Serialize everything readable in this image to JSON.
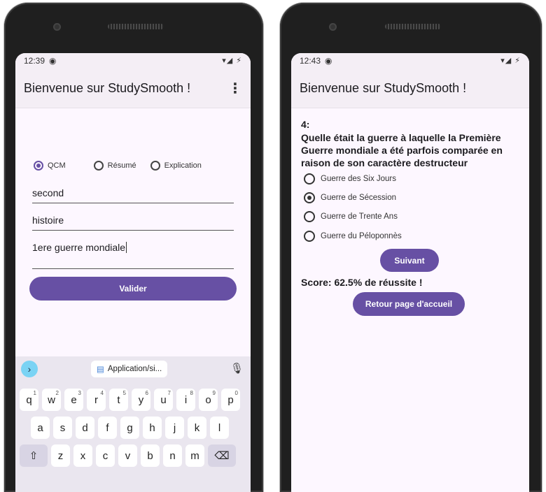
{
  "screen1": {
    "status_time": "12:39",
    "status_icons": "▾◢ ⚡",
    "app_title": "Bienvenue sur StudySmooth !",
    "radios": [
      {
        "label": "QCM",
        "selected": true
      },
      {
        "label": "Résumé",
        "selected": false
      },
      {
        "label": "Explication",
        "selected": false
      }
    ],
    "fields": {
      "level": "second",
      "subject": "histoire",
      "topic": "1ere guerre mondiale"
    },
    "submit_label": "Valider",
    "keyboard": {
      "suggestion_chip": "Application/si...",
      "row1": [
        {
          "k": "q",
          "s": "1"
        },
        {
          "k": "w",
          "s": "2"
        },
        {
          "k": "e",
          "s": "3"
        },
        {
          "k": "r",
          "s": "4"
        },
        {
          "k": "t",
          "s": "5"
        },
        {
          "k": "y",
          "s": "6"
        },
        {
          "k": "u",
          "s": "7"
        },
        {
          "k": "i",
          "s": "8"
        },
        {
          "k": "o",
          "s": "9"
        },
        {
          "k": "p",
          "s": "0"
        }
      ],
      "row2": [
        "a",
        "s",
        "d",
        "f",
        "g",
        "h",
        "j",
        "k",
        "l"
      ],
      "row3": [
        "z",
        "x",
        "c",
        "v",
        "b",
        "n",
        "m"
      ]
    }
  },
  "screen2": {
    "status_time": "12:43",
    "status_icons": "▾◢ ⚡",
    "app_title": "Bienvenue sur StudySmooth !",
    "question_number": "4:",
    "question_text": "Quelle était la guerre à laquelle la Première Guerre mondiale a été parfois comparée en raison de son caractère destructeur",
    "options": [
      {
        "label": "Guerre des Six Jours",
        "selected": false
      },
      {
        "label": "Guerre de Sécession",
        "selected": true
      },
      {
        "label": "Guerre de Trente Ans",
        "selected": false
      },
      {
        "label": "Guerre du Péloponnès",
        "selected": false
      }
    ],
    "next_label": "Suivant",
    "score_text": "Score: 62.5% de réussite !",
    "home_label": "Retour page d'accueil"
  },
  "colors": {
    "primary": "#6750a4",
    "surface": "#fdf7ff",
    "appbar": "#f4eef5"
  }
}
